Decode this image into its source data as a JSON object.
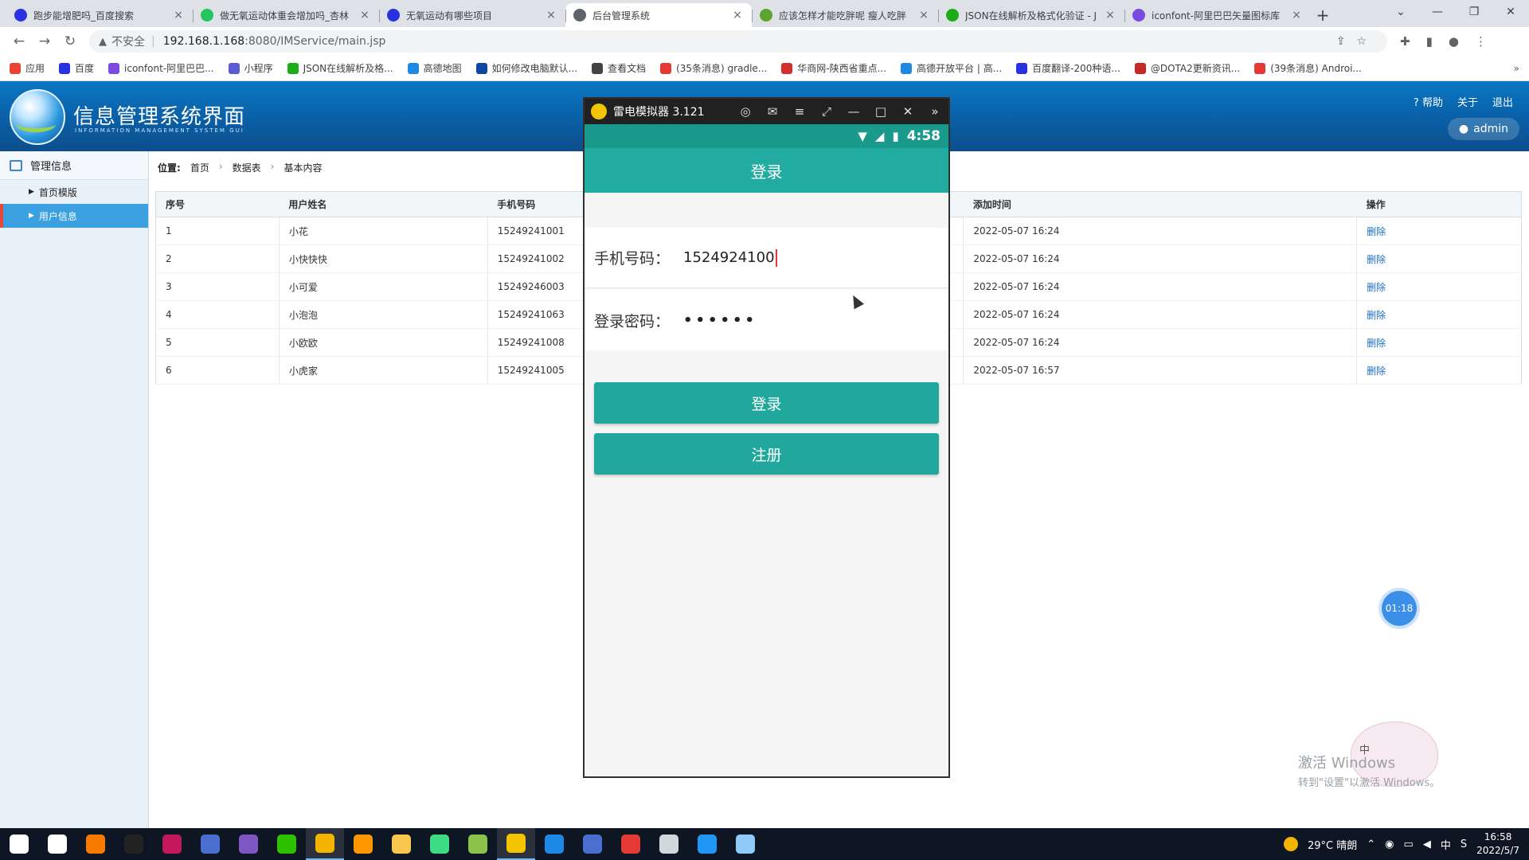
{
  "browser": {
    "tabs": [
      {
        "title": "跑步能增肥吗_百度搜索",
        "color": "#2932e1"
      },
      {
        "title": "做无氧运动体重会增加吗_杏林",
        "color": "#22c55e"
      },
      {
        "title": "无氧运动有哪些项目",
        "color": "#2932e1"
      },
      {
        "title": "后台管理系统",
        "color": "#5f6368"
      },
      {
        "title": "应该怎样才能吃胖呢 瘦人吃胖",
        "color": "#5ba52e"
      },
      {
        "title": "JSON在线解析及格式化验证 - J",
        "color": "#1aad19"
      },
      {
        "title": "iconfont-阿里巴巴矢量图标库",
        "color": "#7b4ae2"
      }
    ],
    "new_tab": "+",
    "insecure_label": "不安全",
    "url_host": "192.168.1.168",
    "url_path": ":8080/IMService/main.jsp",
    "bookmarks": [
      {
        "label": "应用",
        "color": "#ea4335"
      },
      {
        "label": "百度",
        "color": "#2932e1"
      },
      {
        "label": "iconfont-阿里巴巴...",
        "color": "#7b4ae2"
      },
      {
        "label": "小程序",
        "color": "#5b5bd6"
      },
      {
        "label": "JSON在线解析及格...",
        "color": "#1aad19"
      },
      {
        "label": "高德地图",
        "color": "#1e88e5"
      },
      {
        "label": "如何修改电脑默认...",
        "color": "#0d47a1"
      },
      {
        "label": "查看文档",
        "color": "#444444"
      },
      {
        "label": "(35条消息) gradle...",
        "color": "#e53935"
      },
      {
        "label": "华商网-陕西省重点...",
        "color": "#d32f2f"
      },
      {
        "label": "高德开放平台 | 高...",
        "color": "#1e88e5"
      },
      {
        "label": "百度翻译-200种语...",
        "color": "#2932e1"
      },
      {
        "label": "@DOTA2更新资讯...",
        "color": "#c62828"
      },
      {
        "label": "(39条消息) Androi...",
        "color": "#e53935"
      }
    ],
    "bookmarks_more": "»"
  },
  "app": {
    "title": "信息管理系统界面",
    "subtitle": "INFORMATION MANAGEMENT SYSTEM GUI",
    "help": "帮助",
    "about": "关于",
    "logout": "退出",
    "user": "admin",
    "sidebar": {
      "heading": "管理信息",
      "items": [
        {
          "label": "首页模版",
          "active": false
        },
        {
          "label": "用户信息",
          "active": true
        }
      ]
    },
    "breadcrumb": {
      "label": "位置:",
      "items": [
        "首页",
        "数据表",
        "基本内容"
      ]
    },
    "table": {
      "headers": [
        "序号",
        "用户姓名",
        "手机号码",
        "添加时间",
        "操作"
      ],
      "rows": [
        {
          "id": "1",
          "name": "小花",
          "phone": "15249241001",
          "time": "2022-05-07 16:24",
          "action": "删除"
        },
        {
          "id": "2",
          "name": "小快快快",
          "phone": "15249241002",
          "time": "2022-05-07 16:24",
          "action": "删除"
        },
        {
          "id": "3",
          "name": "小可爱",
          "phone": "15249246003",
          "time": "2022-05-07 16:24",
          "action": "删除"
        },
        {
          "id": "4",
          "name": "小泡泡",
          "phone": "15249241063",
          "time": "2022-05-07 16:24",
          "action": "删除"
        },
        {
          "id": "5",
          "name": "小欧欧",
          "phone": "15249241008",
          "time": "2022-05-07 16:24",
          "action": "删除"
        },
        {
          "id": "6",
          "name": "小虎家",
          "phone": "15249241005",
          "time": "2022-05-07 16:57",
          "action": "删除"
        }
      ]
    }
  },
  "emulator": {
    "window_title": "雷电模拟器 3.121",
    "clock": "4:58",
    "screen_title": "登录",
    "phone_label": "手机号码：",
    "phone_value": "1524924100",
    "password_label": "登录密码：",
    "password_value": "••••••",
    "login_button": "登录",
    "register_button": "注册"
  },
  "overlay": {
    "timer": "01:18",
    "activate_title": "激活 Windows",
    "activate_hint": "转到\"设置\"以激活 Windows。",
    "ime": "中"
  },
  "taskbar": {
    "weather": "29°C 晴朗",
    "ime": "中",
    "time": "16:58",
    "date": "2022/5/7",
    "apps": [
      {
        "name": "start",
        "color": "#ffffff"
      },
      {
        "name": "search",
        "color": "#ffffff"
      },
      {
        "name": "app-orange",
        "color": "#f57c00"
      },
      {
        "name": "qq",
        "color": "#222222"
      },
      {
        "name": "intellij",
        "color": "#c2185b"
      },
      {
        "name": "pen-tool",
        "color": "#4a6fd1"
      },
      {
        "name": "visual-studio",
        "color": "#7e57c2"
      },
      {
        "name": "wechat",
        "color": "#2dc100"
      },
      {
        "name": "chrome",
        "color": "#f4b400"
      },
      {
        "name": "sublime",
        "color": "#ff9800"
      },
      {
        "name": "file-explorer",
        "color": "#f9c74f"
      },
      {
        "name": "android-studio",
        "color": "#3ddc84"
      },
      {
        "name": "android",
        "color": "#8bc34a"
      },
      {
        "name": "ldplayer",
        "color": "#f5c400"
      },
      {
        "name": "globe",
        "color": "#1e88e5"
      },
      {
        "name": "pen-tool-2",
        "color": "#4a6fd1"
      },
      {
        "name": "netease-music",
        "color": "#e53935"
      },
      {
        "name": "chat-bubble",
        "color": "#cfd8dc"
      },
      {
        "name": "baidu-netdisk",
        "color": "#2196f3"
      },
      {
        "name": "notepad",
        "color": "#90caf9"
      }
    ]
  }
}
